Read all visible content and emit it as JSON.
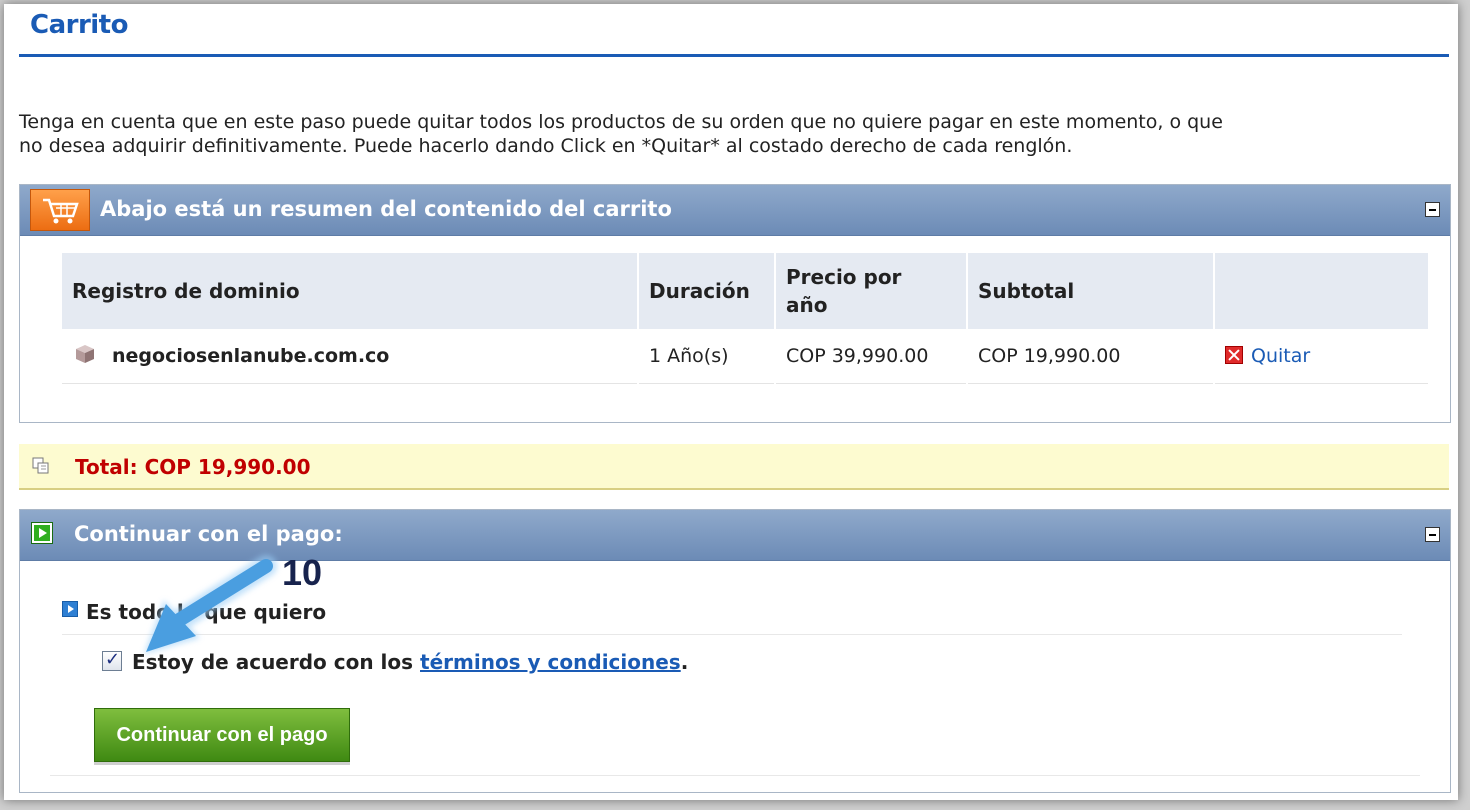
{
  "page": {
    "title": "Carrito",
    "intro_line1": "Tenga en cuenta que en este paso puede quitar todos los productos de su orden que no quiere pagar en este momento, o que",
    "intro_line2": "no desea adquirir definitivamente. Puede hacerlo dando Click en *Quitar* al costado derecho de cada renglón."
  },
  "summary_panel": {
    "title": "Abajo está un resumen del contenido del carrito",
    "columns": {
      "item": "Registro de dominio",
      "duration": "Duración",
      "price_line1": "Precio por",
      "price_line2": "año",
      "subtotal": "Subtotal",
      "action": ""
    },
    "rows": [
      {
        "domain": "negociosenlanube.com.co",
        "duration": "1 Año(s)",
        "price": "COP 39,990.00",
        "subtotal": "COP 19,990.00",
        "remove_label": "Quitar"
      }
    ]
  },
  "total": {
    "label": "Total: COP 19,990.00"
  },
  "checkout_panel": {
    "title": "Continuar con el pago:",
    "option_label": "Es todo lo que quiero",
    "agree_prefix": "Estoy de acuerdo con los ",
    "agree_link": "términos y condiciones",
    "agree_suffix": ".",
    "agree_checked": true,
    "button_label": "Continuar con el pago"
  },
  "annotation": {
    "step_number": "10",
    "arrow_color": "#4a9ee0"
  },
  "colors": {
    "title_blue": "#1a5bb5",
    "header_blue": "#7a97c0",
    "total_red": "#c00000",
    "button_green": "#4f9a1f"
  }
}
